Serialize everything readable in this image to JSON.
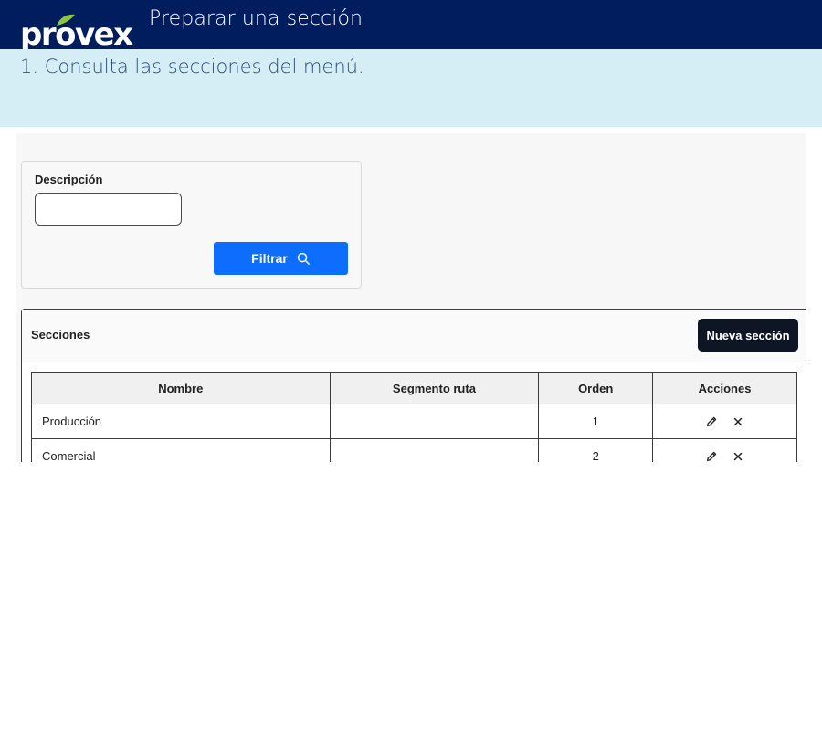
{
  "header": {
    "logo_text": "provex",
    "title": "Preparar una sección"
  },
  "step": {
    "text": "1. Consulta las secciones del menú."
  },
  "filter": {
    "label": "Descripción",
    "input_value": "",
    "button_label": "Filtrar",
    "button_icon": "search-icon"
  },
  "sections": {
    "title": "Secciones",
    "new_button_label": "Nueva sección",
    "columns": [
      "Nombre",
      "Segmento ruta",
      "Orden",
      "Acciones"
    ],
    "rows": [
      {
        "nombre": "Producción",
        "segmento": "",
        "orden": "1"
      },
      {
        "nombre": "Comercial",
        "segmento": "",
        "orden": "2"
      }
    ],
    "row_action_icons": [
      "pencil-icon",
      "close-icon"
    ]
  },
  "colors": {
    "header_bg": "#021d5e",
    "step_band_bg": "#d5eef6",
    "primary_button": "#0d6efd",
    "dark_button": "#0e1626",
    "logo_leaf": "#8cc63f"
  }
}
